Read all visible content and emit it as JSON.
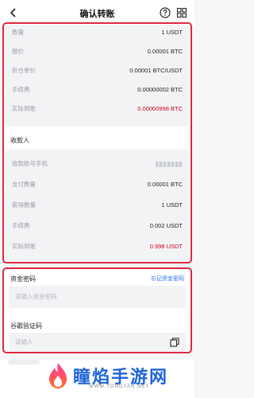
{
  "header": {
    "title": "确认转账"
  },
  "summary": {
    "rows": [
      {
        "label": "数量",
        "value": "1 USDT"
      },
      {
        "label": "报价",
        "value": "0.00001 BTC"
      },
      {
        "label": "折合单价",
        "value": "0.00001 BTC/USDT"
      },
      {
        "label": "手续费",
        "value": "0.00000002 BTC"
      },
      {
        "label": "实际到账",
        "value": "0.00000998 BTC"
      }
    ]
  },
  "payee": {
    "section_label": "收款人",
    "rows": [
      {
        "label": "收款账号手机",
        "value": ""
      },
      {
        "label": "支付数量",
        "value": "0.00001 BTC"
      },
      {
        "label": "获得数量",
        "value": "1 USDT"
      },
      {
        "label": "手续费",
        "value": "0.002 USDT"
      },
      {
        "label": "实际到账",
        "value": "0.998 USDT"
      }
    ]
  },
  "security": {
    "fund_password_label": "资金密码",
    "forgot_label": "忘记资金密码",
    "fund_password_placeholder": "请输入资金密码",
    "google_code_label": "谷歌验证码",
    "google_code_placeholder": "请输入"
  },
  "watermark": {
    "brand_text": "瞳焰手游网",
    "url_text": "WWW.TONGYAN.NET"
  },
  "colors": {
    "highlight_border": "#e0283f",
    "red_value": "#d0021b",
    "link": "#2a6df4"
  }
}
